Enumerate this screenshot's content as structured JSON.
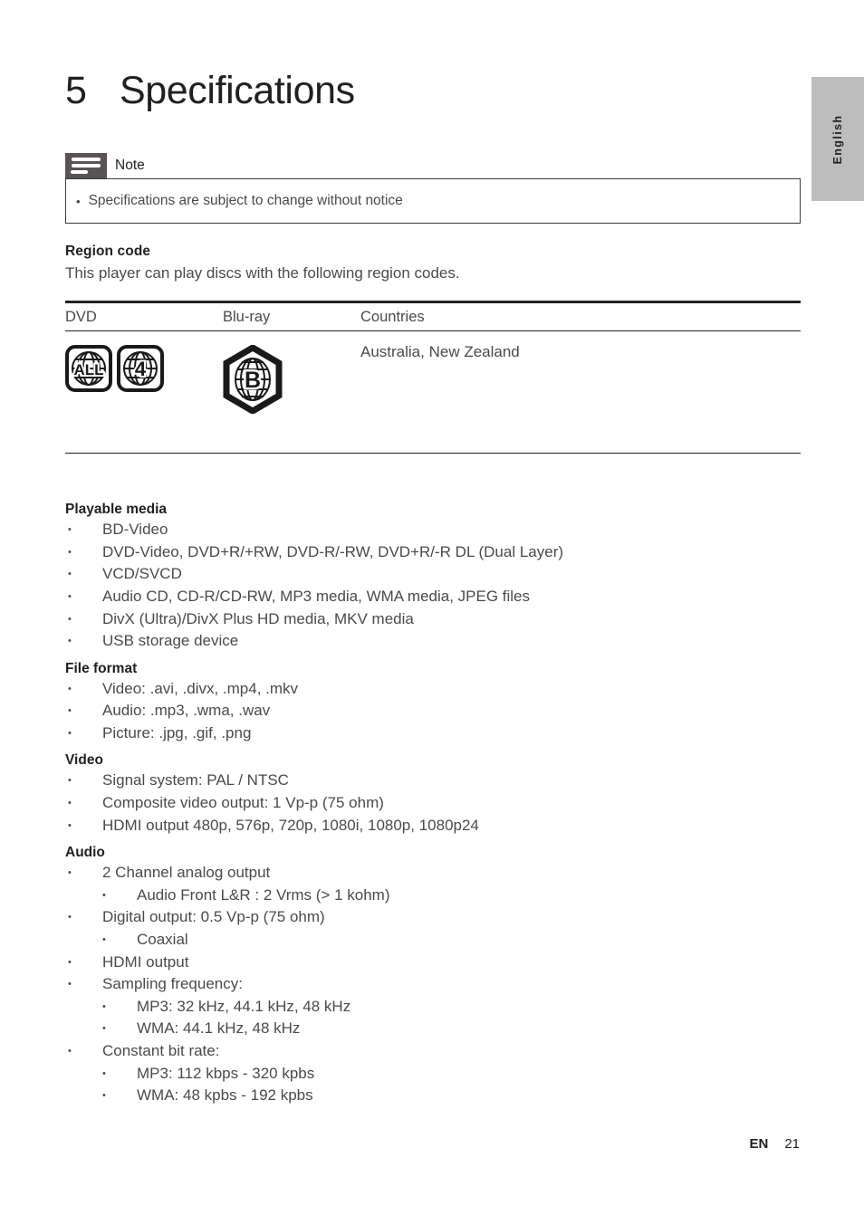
{
  "language_tab": {
    "label": "English"
  },
  "chapter": {
    "number": "5",
    "title": "Specifications"
  },
  "note": {
    "title": "Note",
    "icon": "note-lines-icon",
    "bullet_glyph": "•",
    "items": [
      "Specifications are subject to change without notice"
    ]
  },
  "region_code": {
    "heading": "Region code",
    "intro": "This player can play discs with the following region codes.",
    "table": {
      "columns": [
        "DVD",
        "Blu-ray",
        "Countries"
      ],
      "rows": [
        {
          "dvd_icons": [
            "ALL",
            "4"
          ],
          "bluray_icon": "B",
          "countries": "Australia, New Zealand"
        }
      ]
    }
  },
  "bullet_glyph": "•",
  "sections": [
    {
      "heading": "Playable media",
      "items": [
        {
          "level": 1,
          "text": "BD-Video"
        },
        {
          "level": 1,
          "text": "DVD-Video, DVD+R/+RW, DVD-R/-RW, DVD+R/-R DL (Dual Layer)"
        },
        {
          "level": 1,
          "text": "VCD/SVCD"
        },
        {
          "level": 1,
          "text": "Audio CD, CD-R/CD-RW, MP3 media, WMA media, JPEG files"
        },
        {
          "level": 1,
          "text": "DivX (Ultra)/DivX Plus HD media, MKV media"
        },
        {
          "level": 1,
          "text": "USB storage device"
        }
      ]
    },
    {
      "heading": "File format",
      "items": [
        {
          "level": 1,
          "text": "Video: .avi, .divx, .mp4, .mkv"
        },
        {
          "level": 1,
          "text": "Audio: .mp3, .wma, .wav"
        },
        {
          "level": 1,
          "text": "Picture: .jpg, .gif, .png"
        }
      ]
    },
    {
      "heading": "Video",
      "items": [
        {
          "level": 1,
          "text": "Signal system: PAL / NTSC"
        },
        {
          "level": 1,
          "text": "Composite video output: 1 Vp-p (75 ohm)"
        },
        {
          "level": 1,
          "text": "HDMI output 480p, 576p, 720p, 1080i, 1080p, 1080p24"
        }
      ]
    },
    {
      "heading": "Audio",
      "items": [
        {
          "level": 1,
          "text": "2 Channel analog output"
        },
        {
          "level": 2,
          "text": "Audio Front L&R : 2 Vrms (> 1 kohm)"
        },
        {
          "level": 1,
          "text": "Digital output: 0.5 Vp-p (75 ohm)"
        },
        {
          "level": 2,
          "text": "Coaxial"
        },
        {
          "level": 1,
          "text": "HDMI output"
        },
        {
          "level": 1,
          "text": "Sampling frequency:"
        },
        {
          "level": 2,
          "text": "MP3: 32 kHz, 44.1 kHz, 48 kHz"
        },
        {
          "level": 2,
          "text": "WMA: 44.1 kHz, 48 kHz"
        },
        {
          "level": 1,
          "text": "Constant bit rate:"
        },
        {
          "level": 2,
          "text": "MP3: 112 kbps - 320 kpbs"
        },
        {
          "level": 2,
          "text": "WMA: 48 kpbs - 192 kpbs"
        }
      ]
    }
  ],
  "footer": {
    "language_code": "EN",
    "page_number": "21"
  },
  "colors": {
    "text": "#4a4a4a",
    "heading": "#231f20",
    "note_icon_bg": "#5b5258",
    "tab_bg": "#bdbdbd",
    "rule": "#231f20"
  }
}
